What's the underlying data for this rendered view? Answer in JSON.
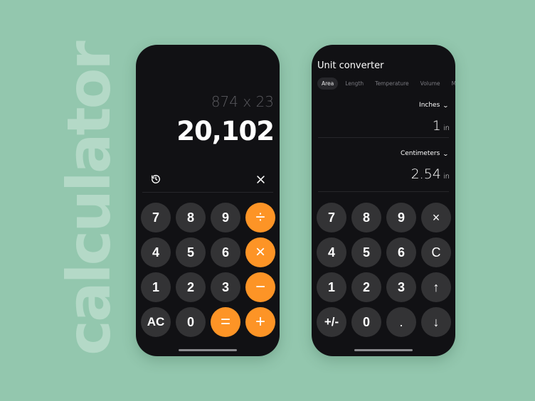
{
  "background_word": "calculator",
  "colors": {
    "background": "#93c7ae",
    "phone": "#111114",
    "key": "#333335",
    "accent": "#fd9426"
  },
  "calculator": {
    "expression": "874 x 23",
    "result": "20,102",
    "history_icon": "history-icon",
    "clear_icon": "close-icon",
    "keys": [
      {
        "label": "7",
        "type": "digit"
      },
      {
        "label": "8",
        "type": "digit"
      },
      {
        "label": "9",
        "type": "digit"
      },
      {
        "label": "÷",
        "type": "operator",
        "name": "divide"
      },
      {
        "label": "4",
        "type": "digit"
      },
      {
        "label": "5",
        "type": "digit"
      },
      {
        "label": "6",
        "type": "digit"
      },
      {
        "label": "×",
        "type": "operator",
        "name": "multiply"
      },
      {
        "label": "1",
        "type": "digit"
      },
      {
        "label": "2",
        "type": "digit"
      },
      {
        "label": "3",
        "type": "digit"
      },
      {
        "label": "−",
        "type": "operator",
        "name": "subtract"
      },
      {
        "label": "AC",
        "type": "function",
        "name": "all-clear"
      },
      {
        "label": "0",
        "type": "digit"
      },
      {
        "label": "=",
        "type": "operator",
        "name": "equals"
      },
      {
        "label": "+",
        "type": "operator",
        "name": "add"
      }
    ]
  },
  "converter": {
    "title": "Unit converter",
    "tabs": [
      {
        "label": "Area",
        "active": true
      },
      {
        "label": "Length",
        "active": false
      },
      {
        "label": "Temperature",
        "active": false
      },
      {
        "label": "Volume",
        "active": false
      },
      {
        "label": "Mass",
        "active": false
      }
    ],
    "from": {
      "unit_name": "Inches",
      "value": "1",
      "unit_abbr": "in"
    },
    "to": {
      "unit_name": "Centimeters",
      "value": "2.54",
      "unit_abbr": "in"
    },
    "keys": [
      {
        "label": "7",
        "type": "digit"
      },
      {
        "label": "8",
        "type": "digit"
      },
      {
        "label": "9",
        "type": "digit"
      },
      {
        "label": "×",
        "type": "function",
        "name": "delete"
      },
      {
        "label": "4",
        "type": "digit"
      },
      {
        "label": "5",
        "type": "digit"
      },
      {
        "label": "6",
        "type": "digit"
      },
      {
        "label": "C",
        "type": "function",
        "name": "clear"
      },
      {
        "label": "1",
        "type": "digit"
      },
      {
        "label": "2",
        "type": "digit"
      },
      {
        "label": "3",
        "type": "digit"
      },
      {
        "label": "↑",
        "type": "function",
        "name": "arrow-up"
      },
      {
        "label": "+/-",
        "type": "function",
        "name": "negate"
      },
      {
        "label": "0",
        "type": "digit"
      },
      {
        "label": ".",
        "type": "function",
        "name": "decimal"
      },
      {
        "label": "↓",
        "type": "function",
        "name": "arrow-down"
      }
    ]
  }
}
